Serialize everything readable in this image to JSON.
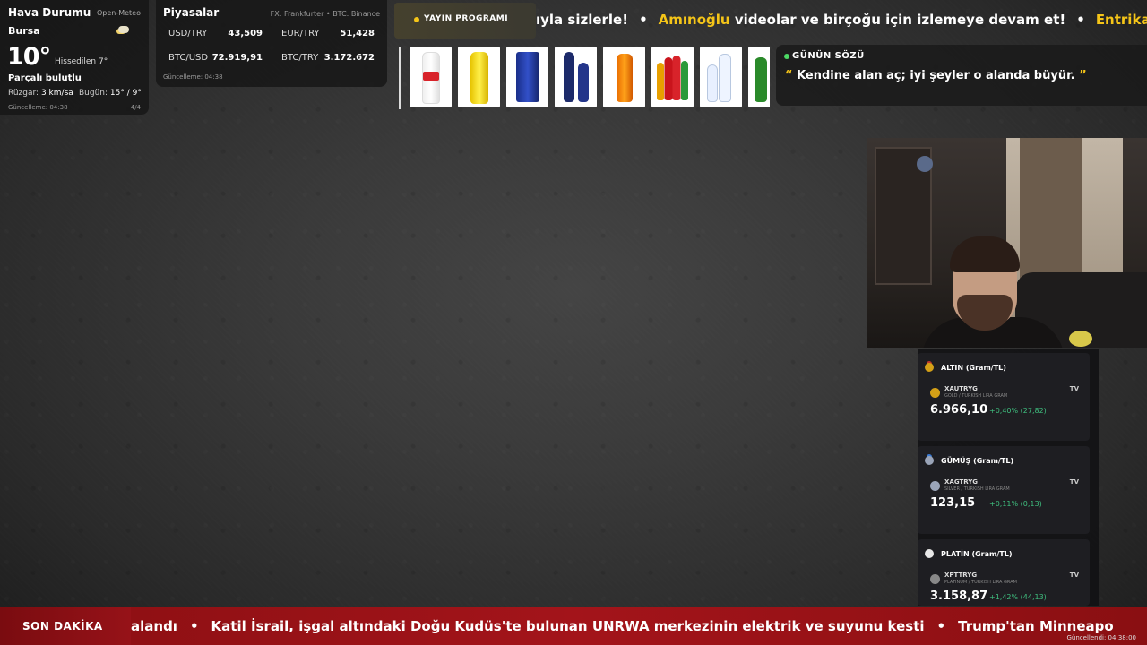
{
  "weather": {
    "title": "Hava Durumu",
    "source": "Open-Meteo",
    "city": "Bursa",
    "temp": "10°",
    "feels": "Hissedilen 7°",
    "condition": "Parçalı bulutlu",
    "wind_label": "Rüzgar:",
    "wind_value": "3 km/sa",
    "today_label": "Bugün:",
    "today_value": "15° / 9°",
    "updated": "Güncelleme: 04:38",
    "page": "4/4",
    "icon": "partly-cloudy-icon"
  },
  "markets": {
    "title": "Piyasalar",
    "source": "FX: Frankfurter • BTC: Binance",
    "rows": [
      {
        "label": "USD/TRY",
        "value": "43,509"
      },
      {
        "label": "EUR/TRY",
        "value": "51,428"
      },
      {
        "label": "BTC/USD",
        "value": "72.919,91"
      },
      {
        "label": "BTC/TRY",
        "value": "3.172.672"
      }
    ],
    "updated": "Güncelleme: 04:38"
  },
  "top_ticker": {
    "schedule_label": "YAYIN PROGRAMI",
    "parts": [
      {
        "text": "ıyla sizlerle!",
        "highlight": ""
      },
      {
        "text": "Amınoğlu",
        "highlight": "yes"
      },
      {
        "text": " videolar ve birçoğu için izlemeye devam et!",
        "highlight": ""
      },
      {
        "text": "Entrika dolu",
        "highlight": "yes"
      }
    ],
    "separator": "•"
  },
  "quote": {
    "title": "GÜNÜN SÖZÜ",
    "open_mark": "“",
    "text": "Kendine alan aç; iyi şeyler o alanda büyür.",
    "close_mark": "”"
  },
  "metals": [
    {
      "title": "ALTIN (Gram/TL)",
      "symbol": "XAUTRYG",
      "desc": "GOLD / TURKISH LIRA GRAM",
      "price": "6.966,10",
      "change": "+0,40% (27,82)",
      "icon": "gold-medal-icon",
      "color": "#d4a017"
    },
    {
      "title": "GÜMÜŞ (Gram/TL)",
      "symbol": "XAGTRYG",
      "desc": "SILVER / TURKISH LIRA GRAM",
      "price": "123,15",
      "change": "+0,11% (0,13)",
      "icon": "silver-medal-icon",
      "color": "#9aa4b8"
    },
    {
      "title": "PLATİN (Gram/TL)",
      "symbol": "XPTTRYG",
      "desc": "PLATINUM / TURKISH LIRA GRAM",
      "price": "3.158,87",
      "change": "+1,42% (44,13)",
      "icon": "platinum-circle-icon",
      "color": "#e8e8e8"
    }
  ],
  "tv_label": "TV",
  "breaking": {
    "label": "SON DAKİKA",
    "items": [
      "alandı",
      "Katil İsrail, işgal altındaki Doğu Kudüs'te bulunan UNRWA merkezinin elektrik ve suyunu kesti",
      "Trump'tan Minneapo"
    ],
    "separator": "•",
    "updated": "Güncellendi: 04:38:00"
  },
  "colors": {
    "accent_yellow": "#f5c518",
    "breaking_red": "#a3141a",
    "positive_green": "#3fbf7f"
  }
}
